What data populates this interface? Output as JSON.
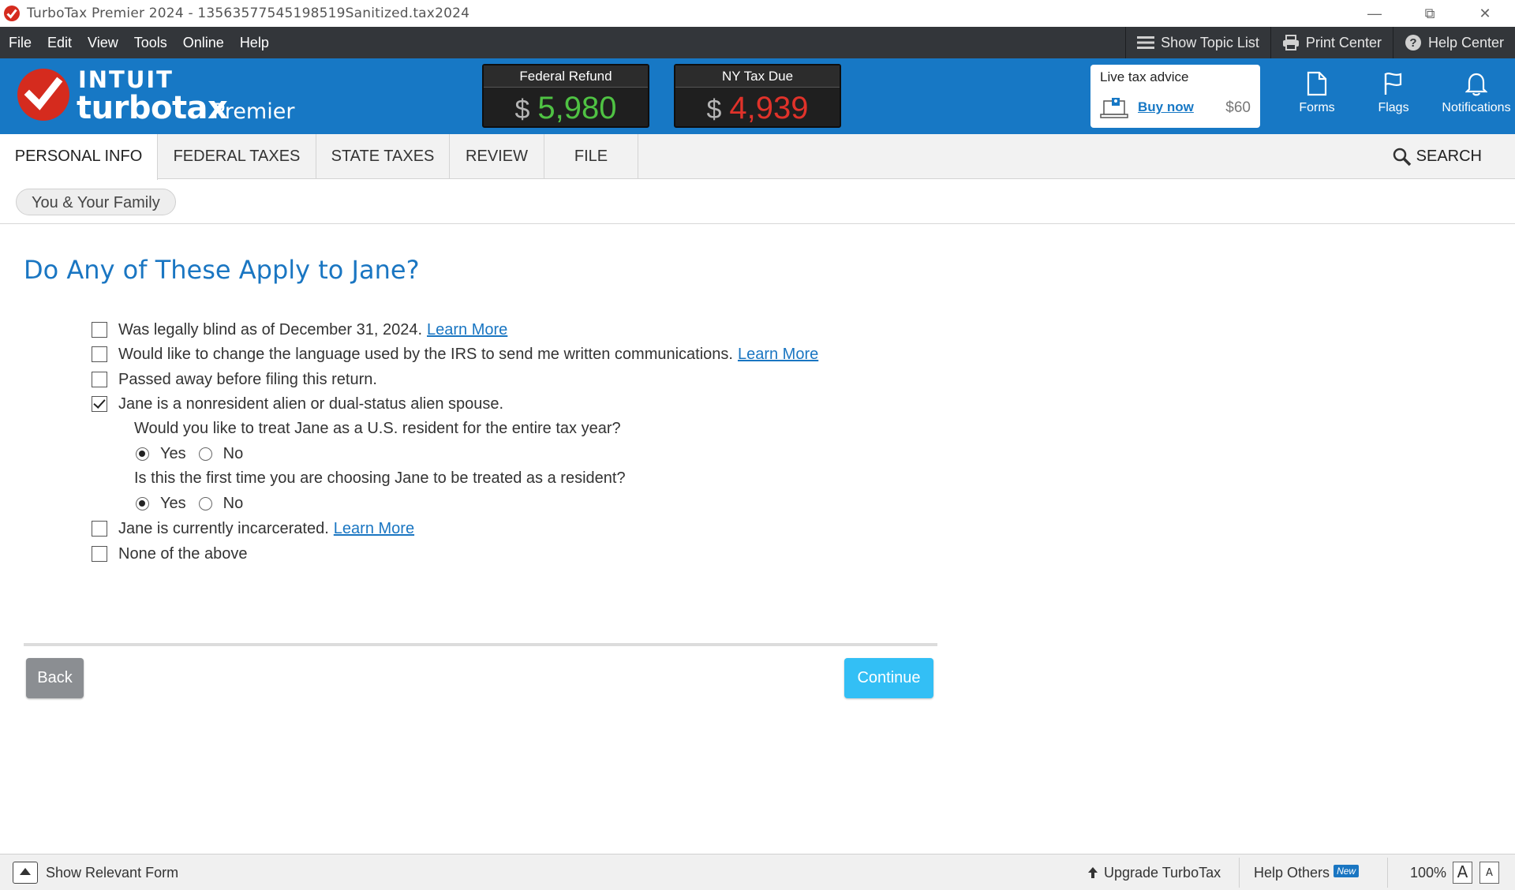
{
  "window": {
    "title": "TurboTax Premier 2024 - 13563577545198519Sanitized.tax2024"
  },
  "menu": {
    "items": [
      "File",
      "Edit",
      "View",
      "Tools",
      "Online",
      "Help"
    ],
    "show_topic_list": "Show Topic List",
    "print_center": "Print Center",
    "help_center": "Help Center"
  },
  "header": {
    "logo_intuit": "INTUIT",
    "logo_product": "turbotax",
    "logo_edition": "Premier",
    "federal": {
      "label": "Federal Refund",
      "currency": "$",
      "amount": "5,980",
      "color": "#4fc243"
    },
    "state": {
      "label": "NY Tax Due",
      "currency": "$",
      "amount": "4,939",
      "color": "#e0322a"
    },
    "advice": {
      "title": "Live tax advice",
      "buy": "Buy now",
      "price": "$60"
    },
    "tools": [
      {
        "icon": "forms-icon",
        "label": "Forms"
      },
      {
        "icon": "flag-icon",
        "label": "Flags"
      },
      {
        "icon": "bell-icon",
        "label": "Notifications"
      }
    ]
  },
  "nav": {
    "tabs": [
      "PERSONAL INFO",
      "FEDERAL TAXES",
      "STATE TAXES",
      "REVIEW",
      "FILE"
    ],
    "active": "PERSONAL INFO",
    "search": "SEARCH"
  },
  "breadcrumb": "You & Your Family",
  "page": {
    "title": "Do Any of These Apply to Jane?",
    "options": [
      {
        "text": "Was legally blind as of December 31, 2024.",
        "link": "Learn More",
        "checked": false
      },
      {
        "text": "Would like to change the language used by the IRS to send me written communications.",
        "link": "Learn More",
        "checked": false
      },
      {
        "text": "Passed away before filing this return.",
        "link": "",
        "checked": false
      },
      {
        "text": "Jane is a nonresident alien or dual-status alien spouse.",
        "link": "",
        "checked": true
      },
      {
        "text": "Jane is currently incarcerated.",
        "link": "Learn More",
        "checked": false
      },
      {
        "text": "None of the above",
        "link": "",
        "checked": false
      }
    ],
    "sub_questions": [
      {
        "text": "Would you like to treat Jane as a U.S. resident for the entire tax year?",
        "yes": "Yes",
        "no": "No",
        "selected": "Yes"
      },
      {
        "text": "Is this the first time you are choosing Jane to be treated as a resident?",
        "yes": "Yes",
        "no": "No",
        "selected": "Yes"
      }
    ],
    "back": "Back",
    "continue": "Continue"
  },
  "status": {
    "show_form": "Show Relevant Form",
    "upgrade": "Upgrade TurboTax",
    "help_others": "Help Others",
    "new_badge": "New",
    "zoom": "100%",
    "font_large": "A",
    "font_small": "A"
  },
  "colors": {
    "brand_blue": "#1778c5",
    "title_blue": "#1a76c2",
    "continue_blue": "#33bff5"
  }
}
